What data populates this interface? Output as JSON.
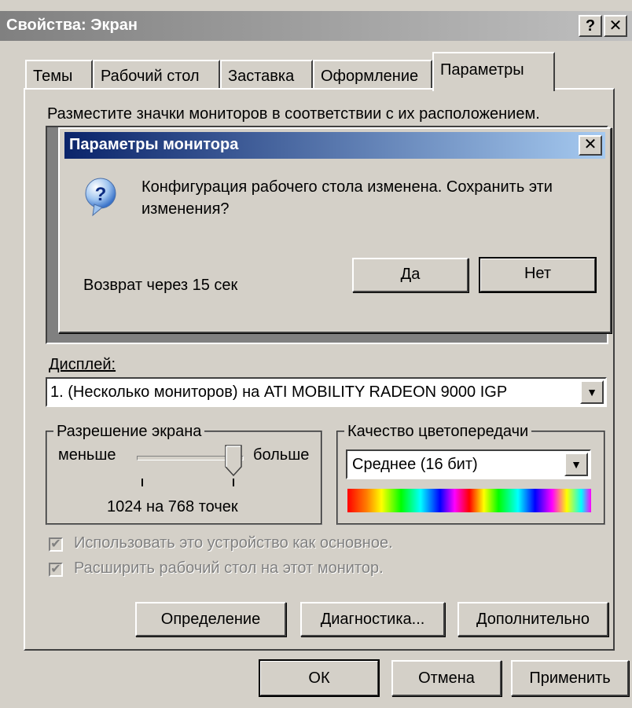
{
  "window": {
    "title": "Свойства: Экран",
    "help_button": "?",
    "close_button": "✕"
  },
  "tabs": [
    {
      "label": "Темы"
    },
    {
      "label": "Рабочий стол"
    },
    {
      "label": "Заставка"
    },
    {
      "label": "Оформление"
    },
    {
      "label": "Параметры",
      "active": true
    }
  ],
  "monitor_area": {
    "instruction": "Разместите значки мониторов в соответствии с их расположением."
  },
  "dialog": {
    "title": "Параметры монитора",
    "close_button": "✕",
    "icon": "question-icon",
    "message": "Конфигурация рабочего стола изменена. Сохранить эти изменения?",
    "countdown": "Возврат через 15 сек",
    "yes_label": "Да",
    "no_label": "Нет"
  },
  "display": {
    "label": "Дисплей:",
    "value": "1. (Несколько мониторов) на ATI MOBILITY RADEON 9000 IGP"
  },
  "resolution": {
    "group_title": "Разрешение экрана",
    "less_label": "меньше",
    "more_label": "больше",
    "value_text": "1024 на 768 точек",
    "slider_level": 0.85
  },
  "color_quality": {
    "group_title": "Качество цветопередачи",
    "value": "Среднее (16 бит)"
  },
  "checkboxes": {
    "primary": {
      "label": "Использовать это устройство как основное.",
      "checked": true,
      "disabled": true
    },
    "extend": {
      "label": "Расширить рабочий стол на этот монитор.",
      "checked": true,
      "disabled": true
    }
  },
  "buttons": {
    "identify": "Определение",
    "troubleshoot": "Диагностика...",
    "advanced": "Дополнительно",
    "ok": "ОК",
    "cancel": "Отмена",
    "apply": "Применить"
  },
  "colors": {
    "face": "#d4d0c8",
    "dialog_title_start": "#0a246a",
    "dialog_title_end": "#a6caf0",
    "inactive_title": "#808080"
  }
}
